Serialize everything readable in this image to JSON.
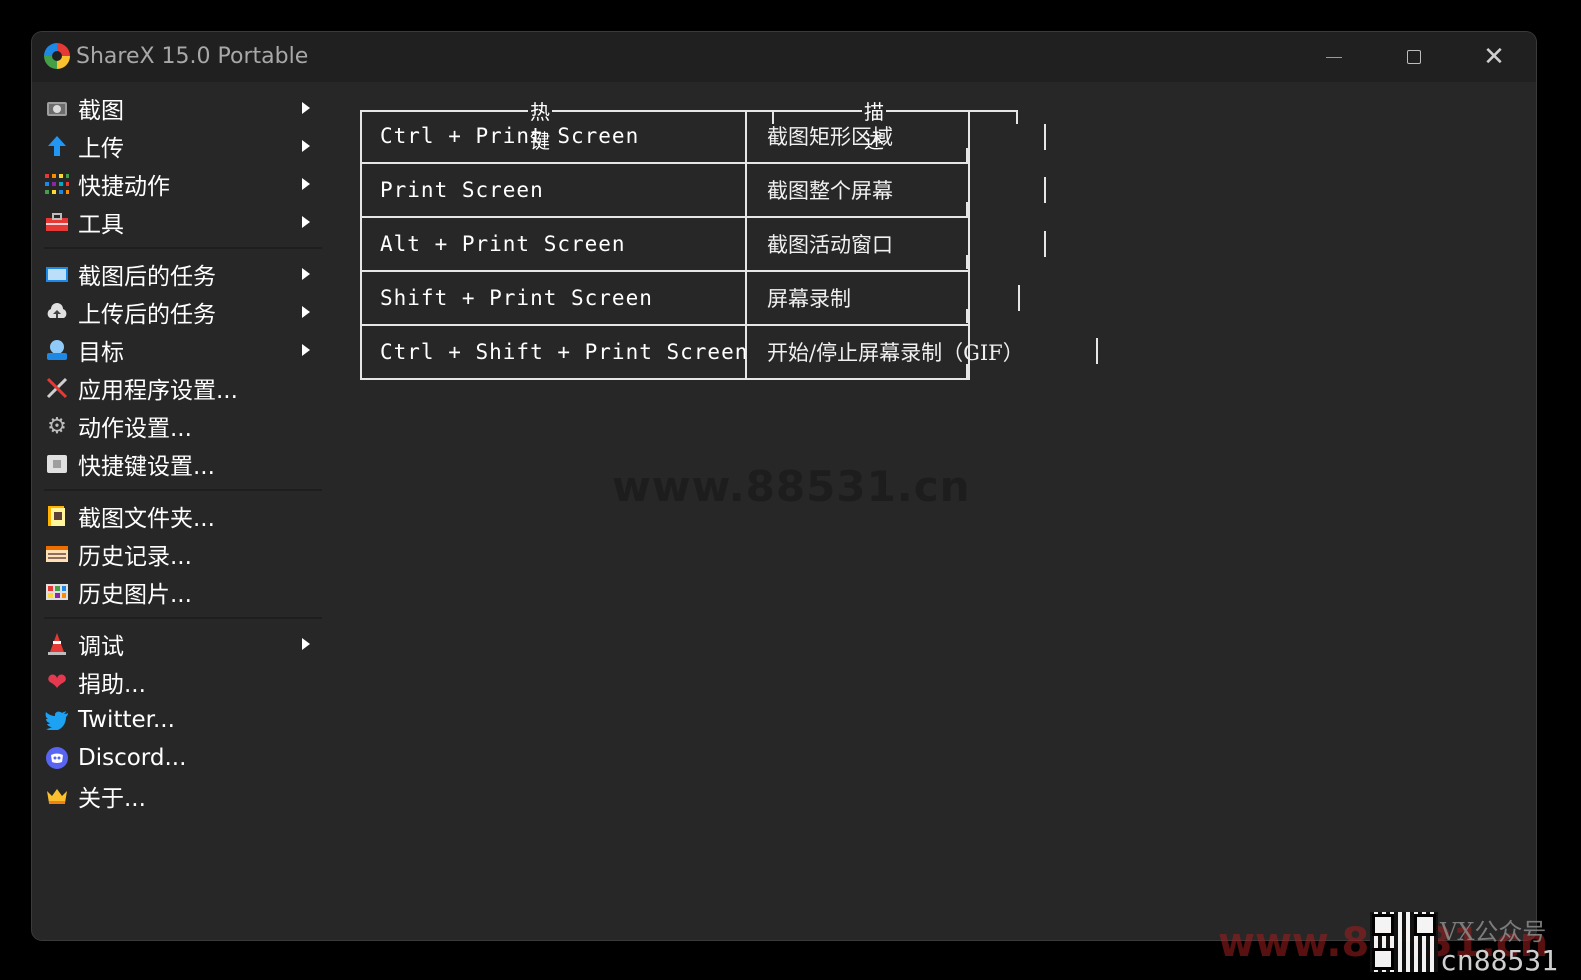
{
  "window": {
    "title": "ShareX 15.0 Portable"
  },
  "menu": {
    "items": [
      {
        "label": "截图",
        "icon": "camera-icon",
        "submenu": true
      },
      {
        "label": "上传",
        "icon": "upload-arrow-icon",
        "submenu": true
      },
      {
        "label": "快捷动作",
        "icon": "grid-dots-icon",
        "submenu": true
      },
      {
        "label": "工具",
        "icon": "toolbox-icon",
        "submenu": true
      },
      {
        "label": "截图后的任务",
        "icon": "after-capture-icon",
        "submenu": true
      },
      {
        "label": "上传后的任务",
        "icon": "cloud-upload-icon",
        "submenu": true
      },
      {
        "label": "目标",
        "icon": "destination-icon",
        "submenu": true
      },
      {
        "label": "应用程序设置...",
        "icon": "tools-icon",
        "submenu": false
      },
      {
        "label": "动作设置...",
        "icon": "gear-icon",
        "submenu": false
      },
      {
        "label": "快捷键设置...",
        "icon": "keyboard-icon",
        "submenu": false
      },
      {
        "label": "截图文件夹...",
        "icon": "folder-icon",
        "submenu": false
      },
      {
        "label": "历史记录...",
        "icon": "history-icon",
        "submenu": false
      },
      {
        "label": "历史图片...",
        "icon": "image-history-icon",
        "submenu": false
      },
      {
        "label": "调试",
        "icon": "cone-icon",
        "submenu": true
      },
      {
        "label": "捐助...",
        "icon": "heart-icon",
        "submenu": false
      },
      {
        "label": "Twitter...",
        "icon": "twitter-icon",
        "submenu": false
      },
      {
        "label": "Discord...",
        "icon": "discord-icon",
        "submenu": false
      },
      {
        "label": "关于...",
        "icon": "crown-icon",
        "submenu": false
      }
    ]
  },
  "table": {
    "header_hotkey": "热键",
    "header_desc": "描述",
    "rows": [
      {
        "hotkey": "Ctrl + Print Screen",
        "desc": "截图矩形区域"
      },
      {
        "hotkey": "Print Screen",
        "desc": "截图整个屏幕"
      },
      {
        "hotkey": "Alt + Print Screen",
        "desc": "截图活动窗口"
      },
      {
        "hotkey": "Shift + Print Screen",
        "desc": "屏幕录制"
      },
      {
        "hotkey": "Ctrl + Shift + Print Screen",
        "desc": "开始/停止屏幕录制（GIF）"
      }
    ]
  },
  "watermarks": {
    "center": "www.88531.cn",
    "bottom": "www.88531.cn",
    "vx": "VX公众号",
    "cn": "cn88531"
  },
  "colors": {
    "window_bg": "#272727",
    "titlebar_bg": "#202020",
    "text": "#ffffff"
  }
}
